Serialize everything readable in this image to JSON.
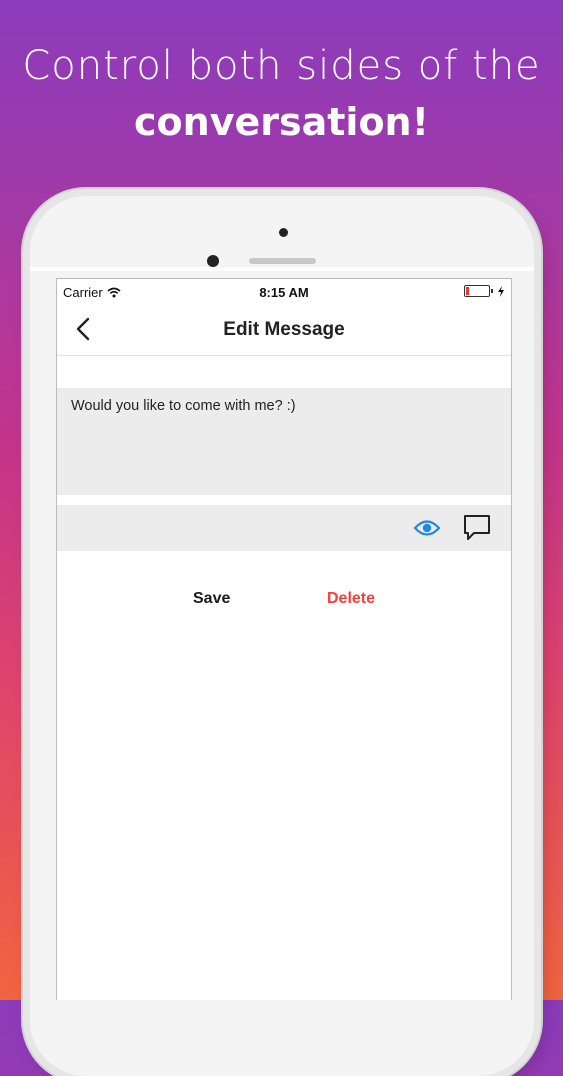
{
  "headline": {
    "line1": "Control both sides of the",
    "line2": "conversation!"
  },
  "statusbar": {
    "carrier": "Carrier",
    "time": "8:15 AM",
    "battery_level": 0.15
  },
  "navbar": {
    "title": "Edit Message"
  },
  "message": {
    "text": "Would you like to come with me? :)"
  },
  "toolbar": {
    "preview_icon": "eye-icon",
    "reply_icon": "speech-bubble-icon"
  },
  "actions": {
    "save_label": "Save",
    "delete_label": "Delete"
  },
  "colors": {
    "accent_blue": "#1e88e5",
    "delete_red": "#f0413c",
    "battery_red": "#e53935"
  }
}
